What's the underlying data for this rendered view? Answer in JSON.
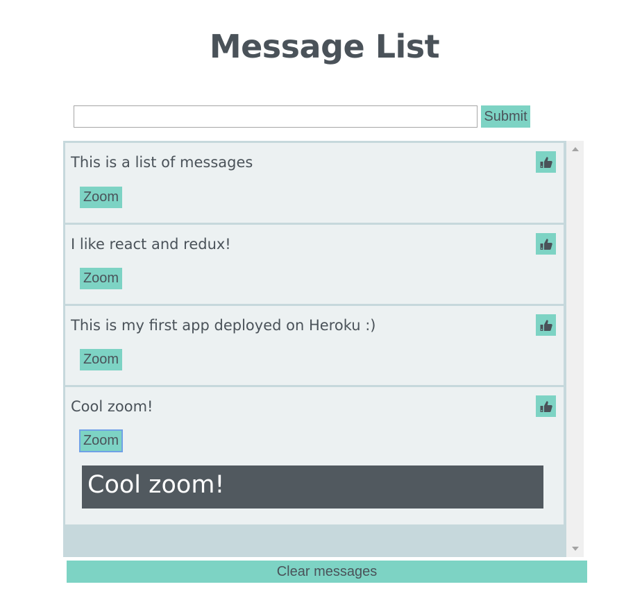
{
  "header": {
    "title": "Message List"
  },
  "composer": {
    "input_value": "",
    "input_placeholder": "",
    "submit_label": "Submit"
  },
  "messages": [
    {
      "text": "This is a list of messages",
      "zoom_label": "Zoom",
      "like_icon": "thumbs-up-icon",
      "zoomed": false
    },
    {
      "text": "I like react and redux!",
      "zoom_label": "Zoom",
      "like_icon": "thumbs-up-icon",
      "zoomed": false
    },
    {
      "text": "This is my first app deployed on Heroku :)",
      "zoom_label": "Zoom",
      "like_icon": "thumbs-up-icon",
      "zoomed": false
    },
    {
      "text": "Cool zoom!",
      "zoom_label": "Zoom",
      "like_icon": "thumbs-up-icon",
      "zoomed": true,
      "zoom_text": "Cool zoom!"
    }
  ],
  "footer": {
    "clear_label": "Clear messages"
  },
  "colors": {
    "accent": "#7dd3c4",
    "text": "#4a5259",
    "card_bg": "#ecf1f2",
    "list_bg": "#c6d8dc",
    "zoom_panel_bg": "#51595f",
    "focus_outline": "#6fa1e6"
  }
}
